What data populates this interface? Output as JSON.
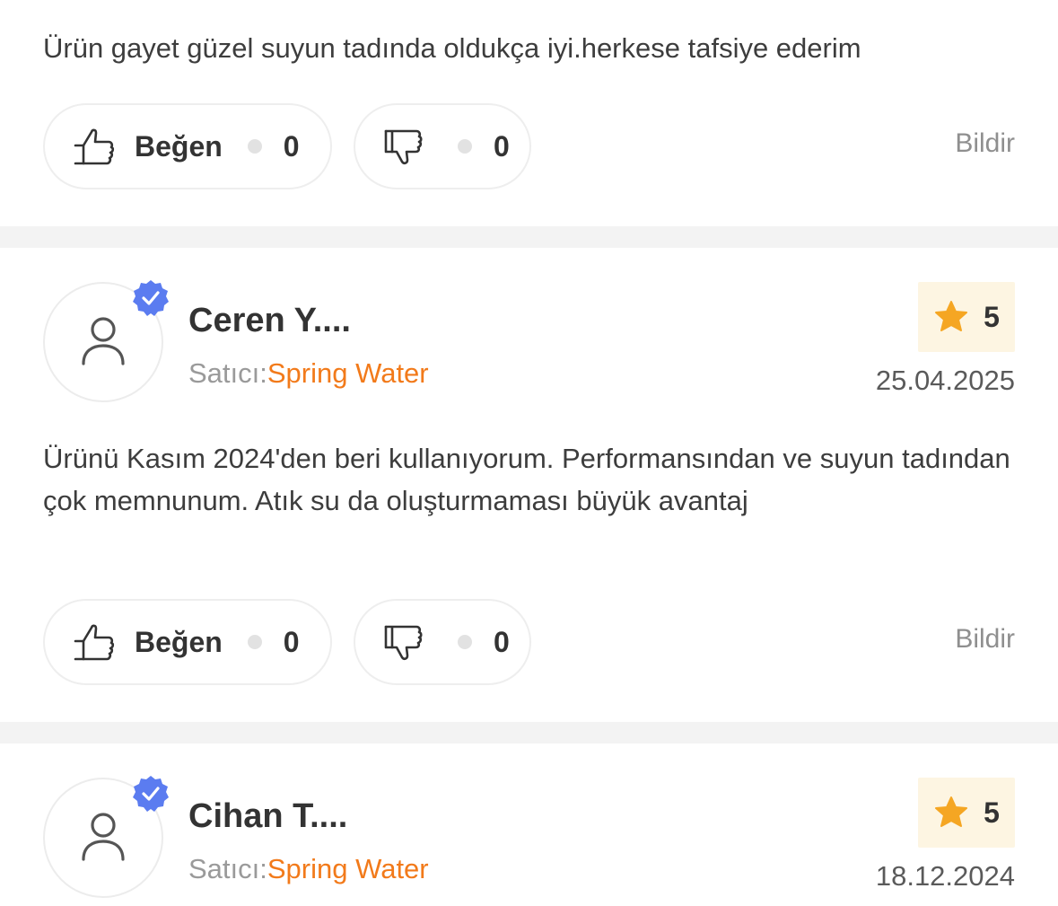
{
  "reviews": [
    {
      "text": "Ürün gayet güzel suyun tadında oldukça iyi.herkese tafsiye ederim",
      "like_label": "Beğen",
      "like_count": "0",
      "dislike_count": "0",
      "report_label": "Bildir"
    },
    {
      "reviewer": "Ceren Y....",
      "seller_prefix": "Satıcı:",
      "seller": "Spring Water",
      "rating": "5",
      "date": "25.04.2025",
      "text": "Ürünü Kasım 2024'den beri kullanıyorum. Performansından ve suyun tadından çok memnunum. Atık su da oluşturmaması büyük avantaj",
      "like_label": "Beğen",
      "like_count": "0",
      "dislike_count": "0",
      "report_label": "Bildir"
    },
    {
      "reviewer": "Cihan T....",
      "seller_prefix": "Satıcı:",
      "seller": "Spring Water",
      "rating": "5",
      "date": "18.12.2024"
    }
  ],
  "colors": {
    "accent": "#f27a1a",
    "star": "#f5a623",
    "verified": "#5b7cf0",
    "rating_bg": "#fdf5e2",
    "divider": "#f3f3f3"
  },
  "icons": {
    "like": "thumbs-up-icon",
    "dislike": "thumbs-down-icon",
    "avatar": "user-icon",
    "verified": "verified-badge-icon",
    "star": "star-icon"
  }
}
